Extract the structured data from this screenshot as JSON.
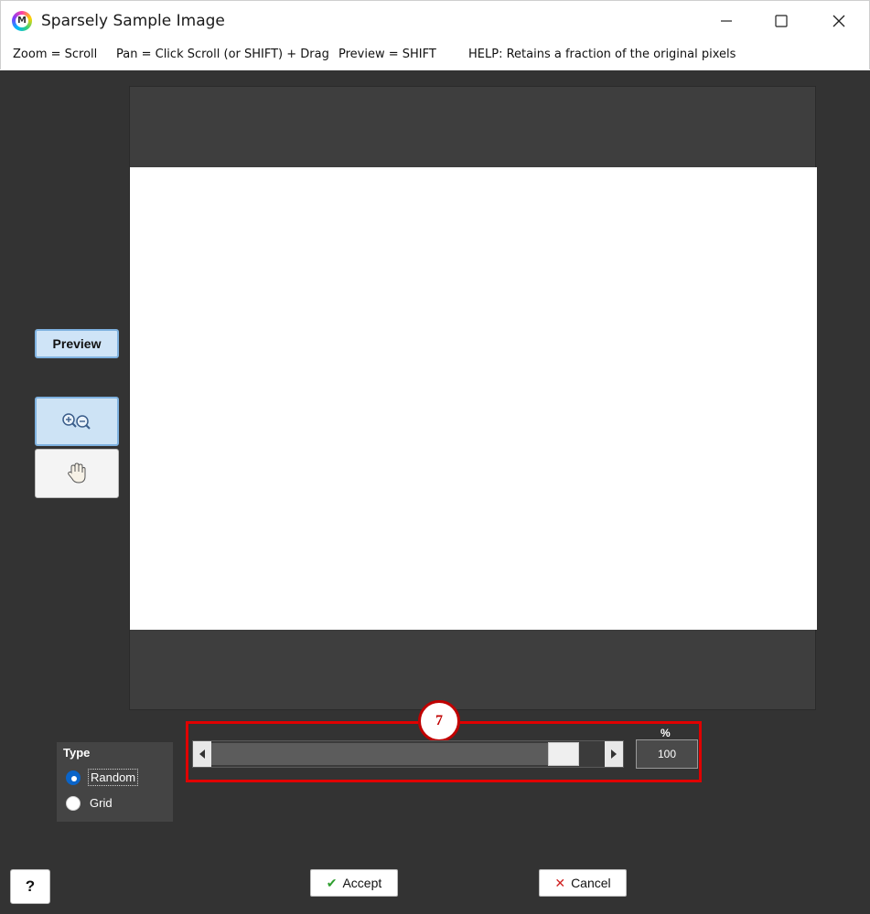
{
  "window": {
    "title": "Sparsely Sample Image",
    "app_icon_letter": "M",
    "controls": [
      "minimize-icon",
      "maximize-icon",
      "close-icon"
    ]
  },
  "hints": {
    "zoom": "Zoom = Scroll",
    "pan": "Pan = Click Scroll (or SHIFT) + Drag",
    "preview": "Preview = SHIFT",
    "help": "HELP:  Retains a fraction of the original pixels"
  },
  "toolbar": {
    "preview_label": "Preview",
    "zoom_tool_icon": "zoom-in-out-icon",
    "pan_tool_icon": "hand-pan-icon"
  },
  "type_group": {
    "title": "Type",
    "options": [
      {
        "label": "Random",
        "checked": true
      },
      {
        "label": "Grid",
        "checked": false
      }
    ]
  },
  "slider": {
    "callout_number": "7",
    "unit_label": "%",
    "value_text": "100",
    "fill_fraction": 0.93
  },
  "footer": {
    "help_label": "?",
    "accept_label": "Accept",
    "cancel_label": "Cancel",
    "accept_icon": "check-icon",
    "cancel_icon": "x-icon"
  },
  "colors": {
    "background": "#333333",
    "callout_border": "#e00000",
    "radio_selected": "#0a64c8",
    "accept_check": "#2e9e2e",
    "cancel_x": "#d02020"
  }
}
